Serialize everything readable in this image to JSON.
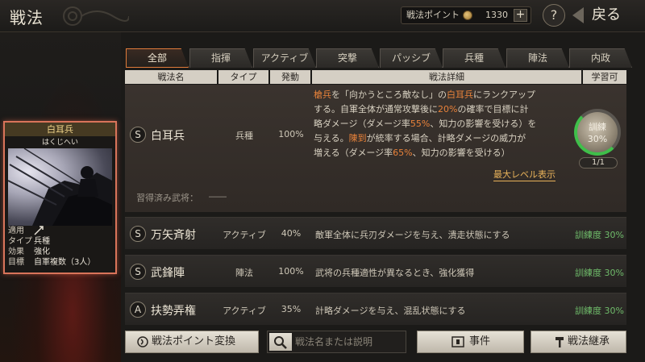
{
  "header": {
    "title": "戦法",
    "points_label": "戦法ポイント",
    "points_value": "1330",
    "plus_label": "+",
    "help_label": "?",
    "back_label": "戻る"
  },
  "tabs": [
    {
      "label": "全部",
      "active": true
    },
    {
      "label": "指揮",
      "active": false
    },
    {
      "label": "アクティブ",
      "active": false
    },
    {
      "label": "突撃",
      "active": false
    },
    {
      "label": "パッシブ",
      "active": false
    },
    {
      "label": "兵種",
      "active": false
    },
    {
      "label": "陣法",
      "active": false
    },
    {
      "label": "内政",
      "active": false
    }
  ],
  "columns": [
    "戦法名",
    "タイプ",
    "発動",
    "戦法詳細",
    "学習可"
  ],
  "selected": {
    "grade": "S",
    "name": "白耳兵",
    "type": "兵種",
    "rate": "100%",
    "desc_lines": [
      {
        "parts": [
          {
            "t": "槍兵",
            "hl": true
          },
          {
            "t": "を「向かうところ敵なし」の",
            "hl": false
          },
          {
            "t": "白耳兵",
            "hl": true
          },
          {
            "t": "にランクアップ",
            "hl": false
          }
        ]
      },
      {
        "parts": [
          {
            "t": "する。自軍全体が通常攻撃後に",
            "hl": false
          },
          {
            "t": "20%",
            "hl": true
          },
          {
            "t": "の確率で目標に計",
            "hl": false
          }
        ]
      },
      {
        "parts": [
          {
            "t": "略ダメージ（ダメージ率",
            "hl": false
          },
          {
            "t": "55%",
            "hl": true
          },
          {
            "t": "、知力の影響を受ける）を",
            "hl": false
          }
        ]
      },
      {
        "parts": [
          {
            "t": "与える。",
            "hl": false
          },
          {
            "t": "陳到",
            "hl": true
          },
          {
            "t": "が統率する場合、計略ダメージの威力が",
            "hl": false
          }
        ]
      },
      {
        "parts": [
          {
            "t": "増える（ダメージ率",
            "hl": false
          },
          {
            "t": "65%",
            "hl": true
          },
          {
            "t": "、知力の影響を受ける）",
            "hl": false
          }
        ]
      }
    ],
    "max_level_label": "最大レベル表示",
    "learned_label": "習得済み武将：",
    "learned_value": "――",
    "train_label": "訓練",
    "train_pct": "30%",
    "train_progress": 0.3,
    "train_count": "1/1"
  },
  "rows": [
    {
      "grade": "S",
      "name": "万矢斉射",
      "type": "アクティブ",
      "rate": "40%",
      "desc": "敵軍全体に兵刃ダメージを与え、潰走状態にする",
      "train": "訓練度 30%"
    },
    {
      "grade": "S",
      "name": "武鋒陣",
      "type": "陣法",
      "rate": "100%",
      "desc": "武将の兵種適性が異なるとき、強化獲得",
      "train": "訓練度 30%"
    },
    {
      "grade": "A",
      "name": "扶勢弄権",
      "type": "アクティブ",
      "rate": "35%",
      "desc": "計略ダメージを与え、混乱状態にする",
      "train": "訓練度 30%"
    }
  ],
  "card": {
    "name": "白耳兵",
    "reading": "はくじへい",
    "info": [
      {
        "k": "適用",
        "v": ""
      },
      {
        "k": "タイプ",
        "v": "兵種"
      },
      {
        "k": "効果",
        "v": "強化"
      },
      {
        "k": "目標",
        "v": "自軍複数（3人）"
      }
    ]
  },
  "bottom": {
    "convert_label": "戦法ポイント変換",
    "search_placeholder": "戦法名または説明",
    "event_label": "事件",
    "inherit_label": "戦法継承"
  },
  "colors": {
    "accent": "#e07b3a",
    "highlight": "#e8823a",
    "train_green": "#6fbb6a"
  }
}
